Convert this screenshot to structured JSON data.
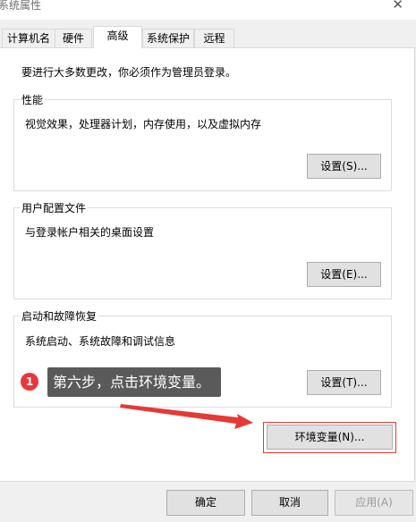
{
  "window": {
    "title": "系统属性",
    "close_glyph": "✕"
  },
  "tabs": [
    {
      "label": "计算机名"
    },
    {
      "label": "硬件"
    },
    {
      "label": "高级",
      "active": true
    },
    {
      "label": "系统保护"
    },
    {
      "label": "远程"
    }
  ],
  "intro_text": "要进行大多数更改，你必须作为管理员登录。",
  "groups": {
    "performance": {
      "title": "性能",
      "description": "视觉效果，处理器计划，内存使用，以及虚拟内存",
      "button": "设置(S)..."
    },
    "user_profiles": {
      "title": "用户配置文件",
      "description": "与登录帐户相关的桌面设置",
      "button": "设置(E)..."
    },
    "startup_recovery": {
      "title": "启动和故障恢复",
      "description": "系统启动、系统故障和调试信息",
      "button": "设置(T)..."
    }
  },
  "env_button": "环境变量(N)...",
  "annotation": {
    "step_number": "1",
    "text": "第六步，点击环境变量。",
    "highlight_color": "#e53935"
  },
  "footer": {
    "ok": "确定",
    "cancel": "取消",
    "apply": "应用(A)"
  }
}
